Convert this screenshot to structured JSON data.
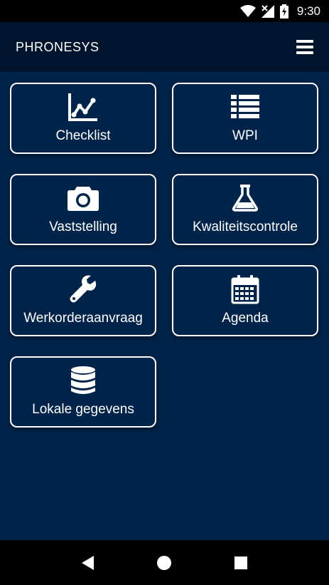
{
  "status_bar": {
    "time": "9:30",
    "icons": [
      "wifi-icon",
      "signal-icon",
      "battery-charging-icon"
    ]
  },
  "app_bar": {
    "title": "PHRONESYS",
    "menu_icon": "hamburger-menu-icon"
  },
  "tiles": [
    {
      "label": "Checklist",
      "icon": "line-chart-icon"
    },
    {
      "label": "WPI",
      "icon": "list-icon"
    },
    {
      "label": "Vaststelling",
      "icon": "camera-icon"
    },
    {
      "label": "Kwaliteitscontrole",
      "icon": "flask-icon"
    },
    {
      "label": "Werkorderaanvraag",
      "icon": "wrench-icon"
    },
    {
      "label": "Agenda",
      "icon": "calendar-icon"
    },
    {
      "label": "Lokale gegevens",
      "icon": "database-icon"
    }
  ],
  "nav_bar": {
    "icons": [
      "back-icon",
      "home-icon",
      "recents-icon"
    ]
  },
  "colors": {
    "background": "#002349",
    "app_bar": "#00152d",
    "tile_border": "#ffffff",
    "text": "#ffffff"
  }
}
